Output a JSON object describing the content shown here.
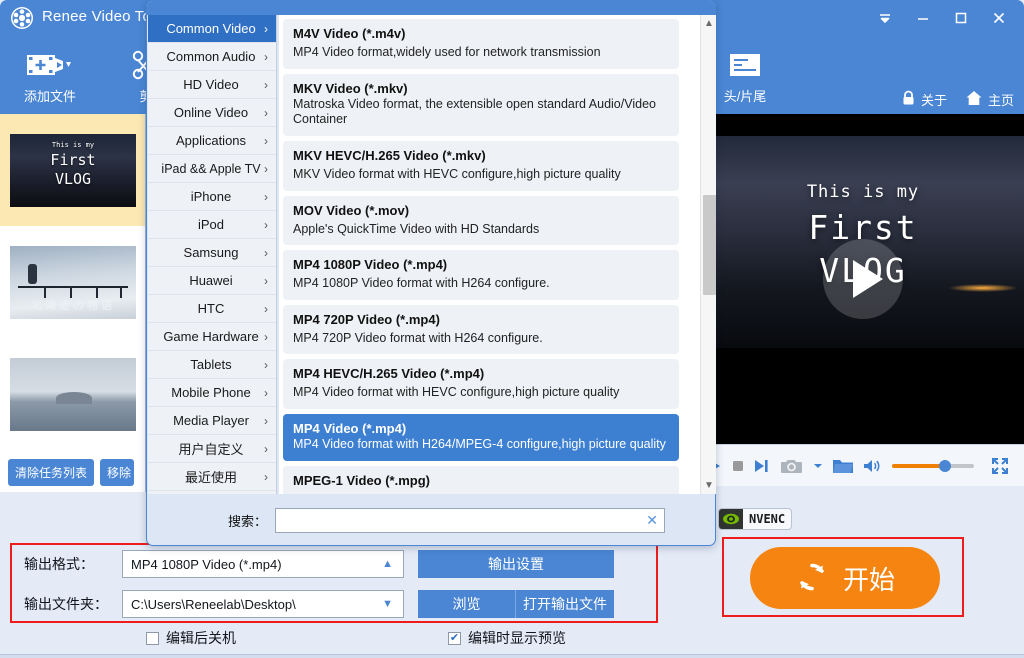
{
  "window": {
    "app_title": "Renee Video Too",
    "logo_icon": "film-reel-icon",
    "controls": {
      "more": "▼",
      "minimize": "—",
      "maximize": "▢",
      "close": "✕"
    }
  },
  "toolbar": {
    "items": [
      {
        "label": "添加文件",
        "icon": "add-file-icon"
      },
      {
        "label": "剪",
        "icon": "cut-icon"
      },
      {
        "label": "头/片尾",
        "icon": "intro-outro-icon"
      }
    ],
    "links": [
      {
        "label": "关于",
        "icon": "lock-icon"
      },
      {
        "label": "主页",
        "icon": "home-icon"
      }
    ]
  },
  "filelist": {
    "items": [
      {
        "title_line1": "This is my",
        "title_line2": "First",
        "title_line3": "VLOG",
        "selected": true
      },
      {
        "caption": "北海道の物语",
        "selected": false
      },
      {
        "caption": "",
        "selected": false
      }
    ],
    "actions": [
      {
        "label": "清除任务列表"
      },
      {
        "label": "移除"
      }
    ]
  },
  "preview": {
    "video_text": {
      "line1": "This is my",
      "line2": "First",
      "line3": "VLOG"
    },
    "play_icon": "play-icon",
    "controls": [
      {
        "name": "play-button",
        "icon": "play-icon"
      },
      {
        "name": "stop-button",
        "icon": "stop-icon"
      },
      {
        "name": "next-frame-button",
        "icon": "next-frame-icon"
      },
      {
        "name": "snapshot-button",
        "icon": "camera-icon"
      },
      {
        "name": "snapshot-dropdown",
        "icon": "chevron-down-icon"
      },
      {
        "name": "open-folder-button",
        "icon": "folder-icon"
      },
      {
        "name": "volume-button",
        "icon": "speaker-icon"
      },
      {
        "name": "fullscreen-button",
        "icon": "fullscreen-icon"
      }
    ],
    "volume_percent": 62,
    "nvenc_badge": "NVENC"
  },
  "start": {
    "label": "开始",
    "icon": "refresh-icon"
  },
  "output": {
    "format_label": "输出格式：",
    "format_value": "MP4 1080P Video (*.mp4)",
    "folder_label": "输出文件夹：",
    "folder_value": "C:\\Users\\Reneelab\\Desktop\\",
    "settings_button": "输出设置",
    "browse_button": "浏览",
    "open_output_button": "打开输出文件",
    "checkbox_shutdown": {
      "label": "编辑后关机",
      "checked": false
    },
    "checkbox_preview": {
      "label": "编辑时显示预览",
      "checked": true
    }
  },
  "popup": {
    "categories": [
      {
        "label": "Common Video",
        "active": true
      },
      {
        "label": "Common Audio",
        "active": false
      },
      {
        "label": "HD Video",
        "active": false
      },
      {
        "label": "Online Video",
        "active": false
      },
      {
        "label": "Applications",
        "active": false
      },
      {
        "label": "iPad && Apple TV",
        "active": false
      },
      {
        "label": "iPhone",
        "active": false
      },
      {
        "label": "iPod",
        "active": false
      },
      {
        "label": "Samsung",
        "active": false
      },
      {
        "label": "Huawei",
        "active": false
      },
      {
        "label": "HTC",
        "active": false
      },
      {
        "label": "Game Hardware",
        "active": false
      },
      {
        "label": "Tablets",
        "active": false
      },
      {
        "label": "Mobile Phone",
        "active": false
      },
      {
        "label": "Media Player",
        "active": false
      },
      {
        "label": "用户自定义",
        "active": false
      },
      {
        "label": "最近使用",
        "active": false
      }
    ],
    "chevron": "›",
    "formats": [
      {
        "title": "M4V Video (*.m4v)",
        "desc": "MP4 Video format,widely used for network transmission",
        "selected": false
      },
      {
        "title": "MKV Video (*.mkv)",
        "desc": "Matroska Video format, the extensible open standard Audio/Video Container",
        "selected": false,
        "tight": true
      },
      {
        "title": "MKV HEVC/H.265 Video (*.mkv)",
        "desc": "MKV Video format with HEVC configure,high picture quality",
        "selected": false
      },
      {
        "title": "MOV Video (*.mov)",
        "desc": "Apple's QuickTime Video with HD Standards",
        "selected": false
      },
      {
        "title": "MP4 1080P Video (*.mp4)",
        "desc": "MP4 1080P Video format with H264 configure.",
        "selected": false
      },
      {
        "title": "MP4 720P Video (*.mp4)",
        "desc": "MP4 720P Video format with H264 configure.",
        "selected": false
      },
      {
        "title": "MP4 HEVC/H.265 Video (*.mp4)",
        "desc": "MP4 Video format with HEVC configure,high picture quality",
        "selected": false
      },
      {
        "title": "MP4 Video (*.mp4)",
        "desc": "MP4 Video format with H264/MPEG-4 configure,high picture quality",
        "selected": true
      },
      {
        "title": "MPEG-1 Video (*.mpg)",
        "desc": "",
        "selected": false
      }
    ],
    "search_label": "搜索：",
    "search_value": "",
    "search_placeholder": "",
    "search_clear_icon": "close-icon",
    "scroll_up_icon": "chevron-up-icon",
    "scroll_down_icon": "chevron-down-icon"
  },
  "colors": {
    "brand_blue": "#4a86d4",
    "accent_orange": "#f58410",
    "highlight_red": "#ef1c1c",
    "panel_bg": "#e4eaf6"
  }
}
